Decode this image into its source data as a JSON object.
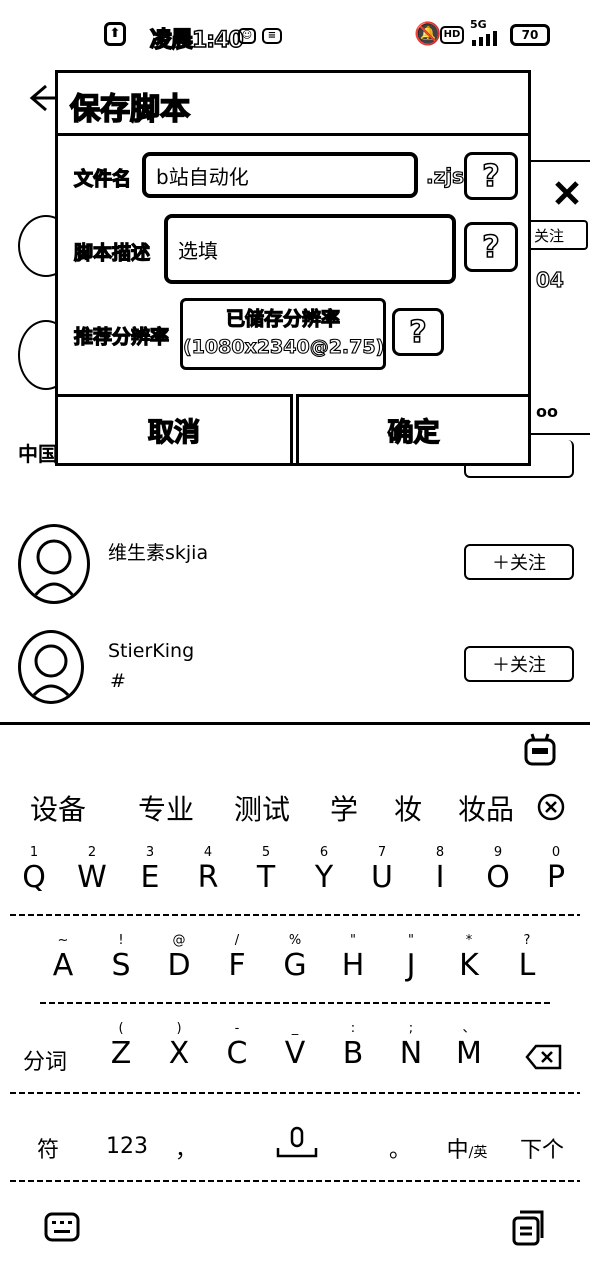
{
  "status_bar": {
    "time": "凌晨1:40",
    "network": "5G",
    "battery": "70"
  },
  "background_list": {
    "follow_button_partial": "关注",
    "users": [
      {
        "name": "维生素skjia",
        "subtitle": "",
        "follow_label": "＋关注"
      },
      {
        "name": "StierKing",
        "subtitle": "#",
        "follow_label": "＋关注"
      }
    ],
    "side_text_1": "04",
    "side_text_2": "中国"
  },
  "dialog": {
    "title": "保存脚本",
    "filename_label": "文件名",
    "filename_value": "b站自动化",
    "filename_ext": ".zjs",
    "help_glyph": "?",
    "desc_label": "脚本描述",
    "desc_placeholder": "选填",
    "res_label": "推荐分辨率",
    "res_line1": "已储存分辨率",
    "res_line2": "(1080x2340@2.75)",
    "cancel_label": "取消",
    "confirm_label": "确定"
  },
  "keyboard": {
    "candidates": [
      "设备",
      "专业",
      "测试",
      "学",
      "妆",
      "妆品"
    ],
    "row1": [
      {
        "k": "Q",
        "h": "1"
      },
      {
        "k": "W",
        "h": "2"
      },
      {
        "k": "E",
        "h": "3"
      },
      {
        "k": "R",
        "h": "4"
      },
      {
        "k": "T",
        "h": "5"
      },
      {
        "k": "Y",
        "h": "6"
      },
      {
        "k": "U",
        "h": "7"
      },
      {
        "k": "I",
        "h": "8"
      },
      {
        "k": "O",
        "h": "9"
      },
      {
        "k": "P",
        "h": "0"
      }
    ],
    "row2": [
      {
        "k": "A",
        "h": "~"
      },
      {
        "k": "S",
        "h": "!"
      },
      {
        "k": "D",
        "h": "@"
      },
      {
        "k": "F",
        "h": "/"
      },
      {
        "k": "G",
        "h": "%"
      },
      {
        "k": "H",
        "h": "\""
      },
      {
        "k": "J",
        "h": "\""
      },
      {
        "k": "K",
        "h": "*"
      },
      {
        "k": "L",
        "h": "?"
      }
    ],
    "row3": [
      {
        "k": "Z",
        "h": "("
      },
      {
        "k": "X",
        "h": ")"
      },
      {
        "k": "C",
        "h": "-"
      },
      {
        "k": "V",
        "h": "_"
      },
      {
        "k": "B",
        "h": ":"
      },
      {
        "k": "N",
        "h": ";"
      },
      {
        "k": "M",
        "h": "、"
      }
    ],
    "segment_label": "分词",
    "symbol_label": "符",
    "num_label": "123",
    "comma_label": "，",
    "period_label": "。",
    "lang_label_main": "中",
    "lang_label_sub": "/英",
    "next_label": "下个"
  }
}
